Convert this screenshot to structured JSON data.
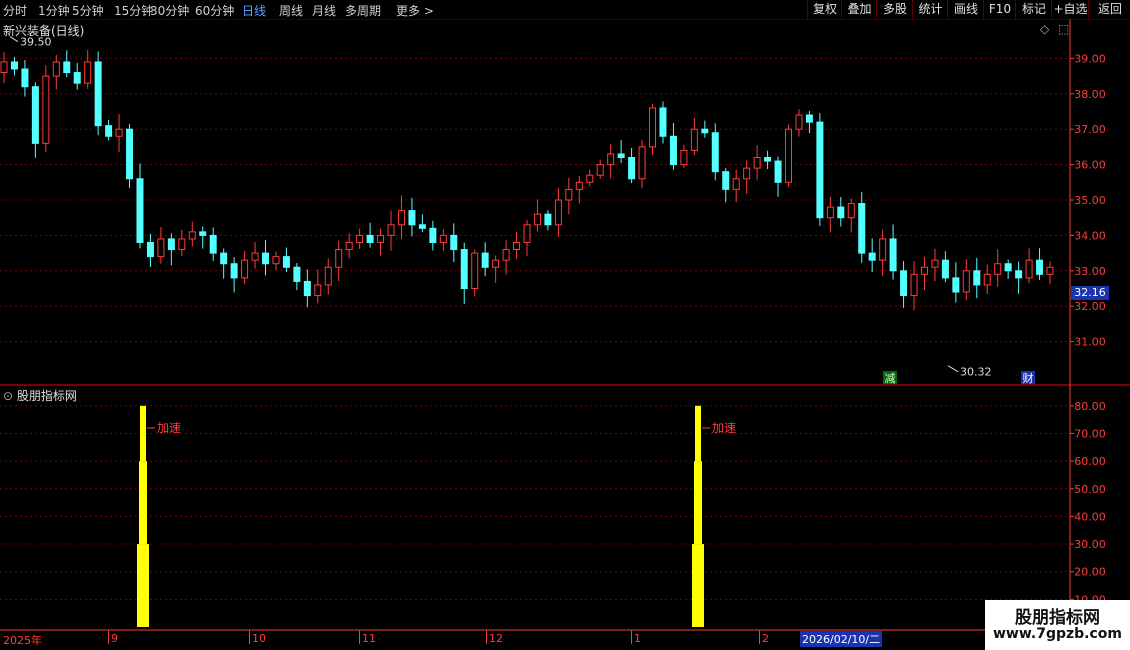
{
  "toolbar": {
    "periods": [
      "分时",
      "1分钟",
      "5分钟",
      "15分钟",
      "30分钟",
      "60分钟",
      "日线",
      "周线",
      "月线",
      "多周期",
      "更多 >"
    ],
    "active": "日线",
    "right": [
      "复权",
      "叠加",
      "多股",
      "统计",
      "画线",
      "F10",
      "标记",
      "+自选",
      "返回"
    ]
  },
  "main_panel": {
    "title": "新兴装备(日线)"
  },
  "indicator_panel": {
    "title": "股朋指标网"
  },
  "current_price": "32.16",
  "high_label": "39.50",
  "low_label": "30.32",
  "markers": {
    "reduce": "减",
    "finance": "财"
  },
  "bottom_axis": {
    "start": "2025年",
    "months": [
      "9",
      "10",
      "11",
      "12",
      "1",
      "2"
    ],
    "cursor_date": "2026/02/10/二"
  },
  "watermark": {
    "line1": "股朋指标网",
    "line2": "www.7gpzb.com"
  },
  "colors": {
    "up": "#ff3b3b",
    "down": "#54ffff",
    "bar": "#ffff00",
    "grid": "#7a0000",
    "axis": "#ff3b3b"
  },
  "chart_data": [
    {
      "type": "candlestick",
      "title": "新兴装备(日线)",
      "ylim": [
        30.0,
        40.0
      ],
      "yticks": [
        "31.00",
        "32.00",
        "33.00",
        "34.00",
        "35.00",
        "36.00",
        "37.00",
        "38.00",
        "39.00"
      ],
      "high": 39.5,
      "low": 30.32,
      "last": 32.16,
      "close_path": [
        38.9,
        38.7,
        38.2,
        36.6,
        38.5,
        38.9,
        38.6,
        38.3,
        38.9,
        37.1,
        36.8,
        37.0,
        35.6,
        33.8,
        33.4,
        33.9,
        33.6,
        33.9,
        34.1,
        34.0,
        33.5,
        33.2,
        32.8,
        33.3,
        33.5,
        33.2,
        33.4,
        33.1,
        32.7,
        32.3,
        32.6,
        33.1,
        33.6,
        33.8,
        34.0,
        33.8,
        34.0,
        34.3,
        34.7,
        34.3,
        34.2,
        33.8,
        34.0,
        33.6,
        32.5,
        33.5,
        33.1,
        33.3,
        33.6,
        33.8,
        34.3,
        34.6,
        34.3,
        35.0,
        35.3,
        35.5,
        35.7,
        36.0,
        36.3,
        36.2,
        35.6,
        36.5,
        37.6,
        36.8,
        36.0,
        36.4,
        37.0,
        36.9,
        35.8,
        35.3,
        35.6,
        35.9,
        36.2,
        36.1,
        35.5,
        37.0,
        37.4,
        37.2,
        34.5,
        34.8,
        34.5,
        34.9,
        33.5,
        33.3,
        33.9,
        33.0,
        32.3,
        32.9,
        33.1,
        33.3,
        32.8,
        32.4,
        33.0,
        32.6,
        32.9,
        33.2,
        33.0,
        32.8,
        33.3,
        32.9,
        33.1
      ]
    },
    {
      "type": "bar",
      "title": "股朋指标网",
      "ylim": [
        0,
        85
      ],
      "yticks": [
        "10.00",
        "20.00",
        "30.00",
        "40.00",
        "50.00",
        "60.00",
        "70.00",
        "80.00"
      ],
      "series": [
        {
          "segments": [
            30,
            60,
            80
          ]
        },
        {
          "segments": [
            30,
            60,
            80
          ]
        }
      ],
      "annotations": [
        "加速",
        "加速"
      ]
    }
  ]
}
